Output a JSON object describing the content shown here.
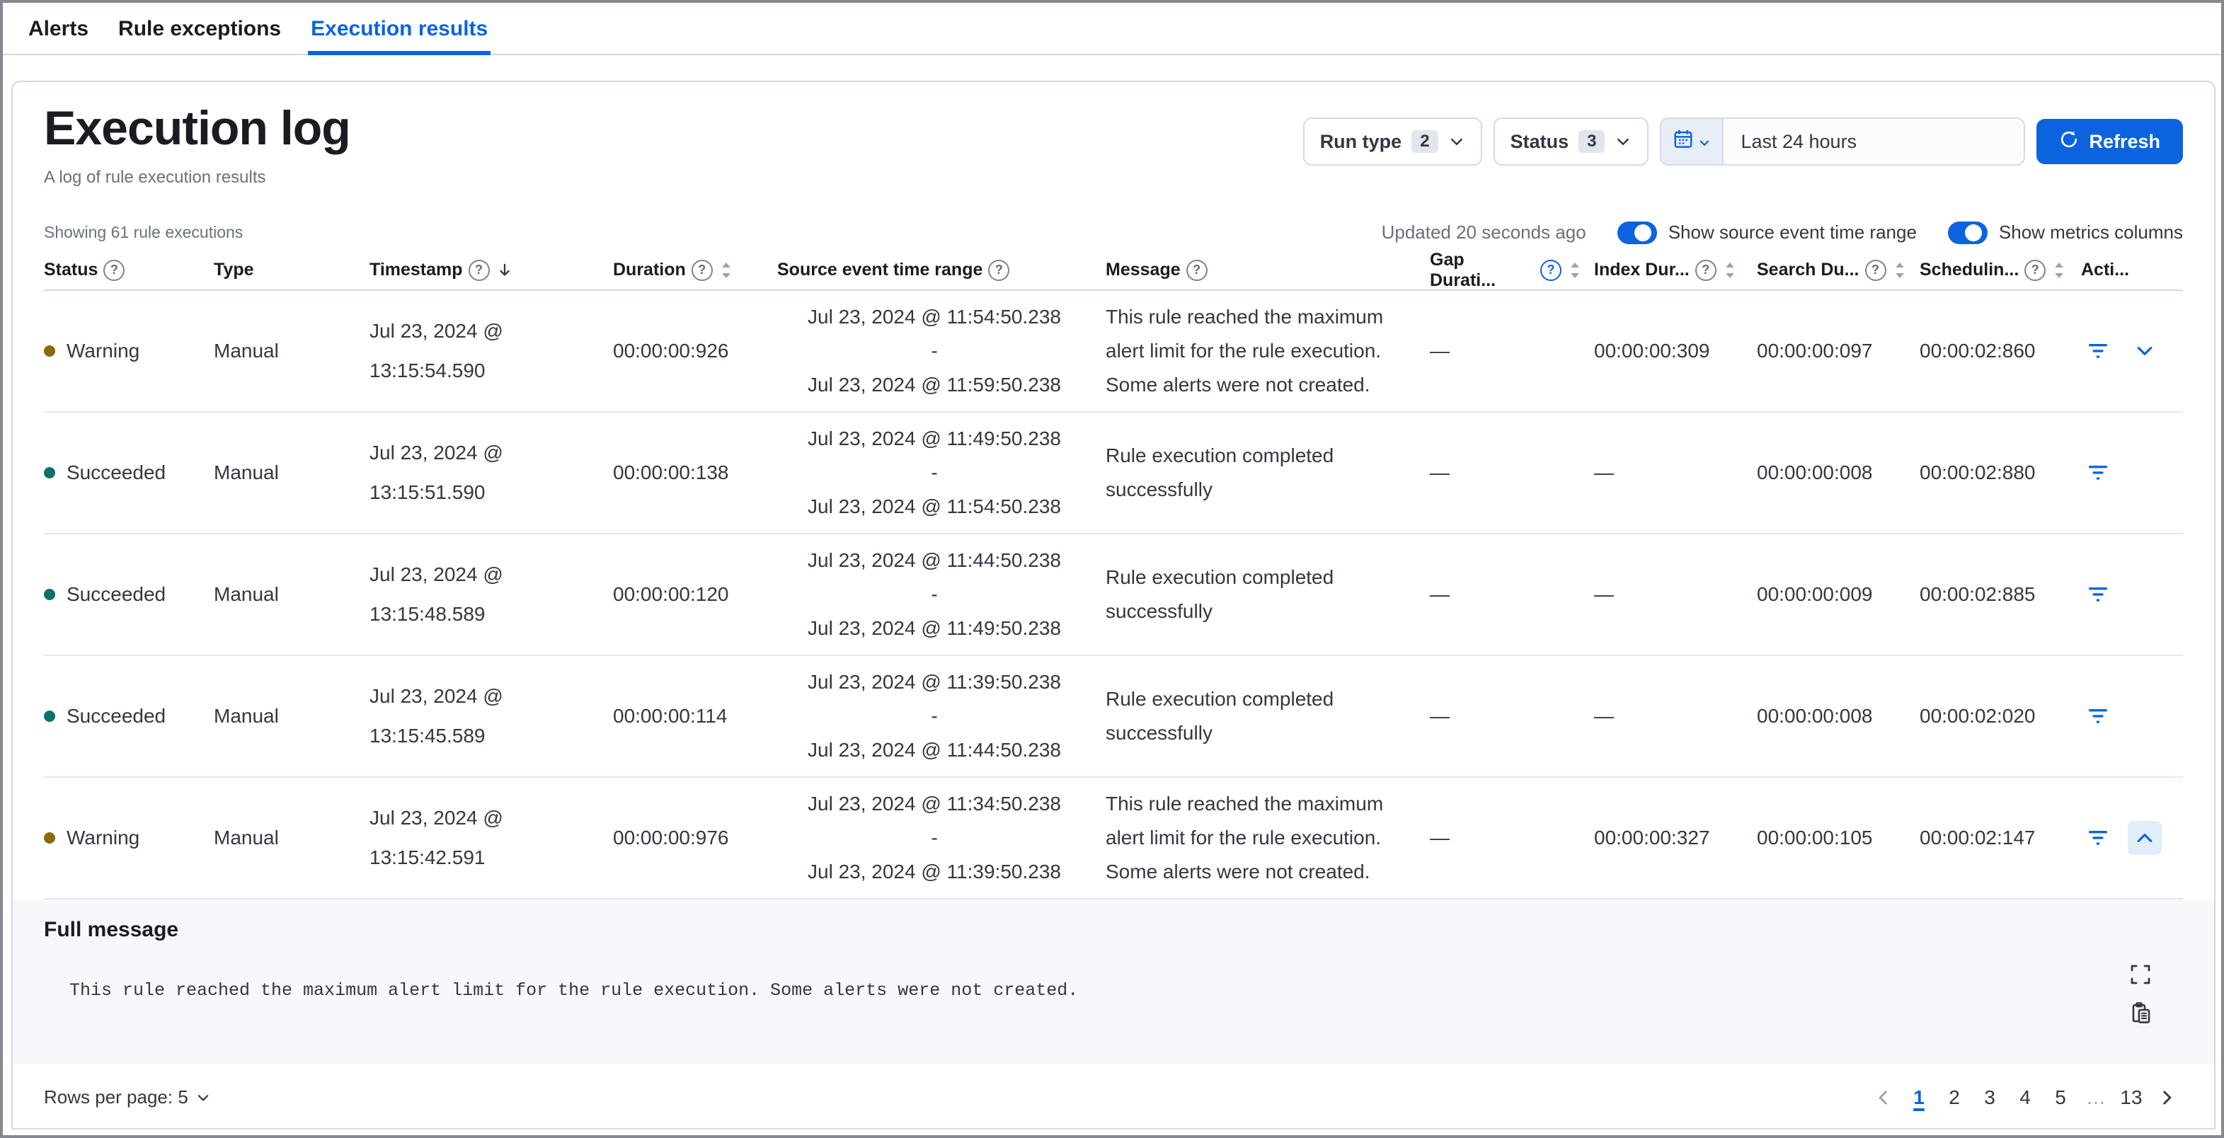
{
  "tabs": [
    {
      "label": "Alerts",
      "active": false
    },
    {
      "label": "Rule exceptions",
      "active": false
    },
    {
      "label": "Execution results",
      "active": true
    }
  ],
  "header": {
    "title": "Execution log",
    "subtitle": "A log of rule execution results"
  },
  "filters": {
    "run_type": {
      "label": "Run type",
      "count": "2",
      "icon": "chevron-down-icon"
    },
    "status": {
      "label": "Status",
      "count": "3",
      "icon": "chevron-down-icon"
    },
    "date_range": {
      "value": "Last 24 hours",
      "icon": "calendar-icon"
    },
    "refresh": {
      "label": "Refresh",
      "icon": "refresh-icon"
    }
  },
  "meta": {
    "showing": "Showing 61 rule executions",
    "updated": "Updated 20 seconds ago",
    "toggles": [
      {
        "label": "Show source event time range",
        "on": true
      },
      {
        "label": "Show metrics columns",
        "on": true
      }
    ]
  },
  "table": {
    "range_separator": "-",
    "columns": [
      {
        "label": "Status",
        "help": true
      },
      {
        "label": "Type"
      },
      {
        "label": "Timestamp",
        "help": true,
        "sort": "desc"
      },
      {
        "label": "Duration",
        "help": true,
        "sort": "sortable"
      },
      {
        "label": "Source event time range",
        "help": true
      },
      {
        "label": "Message",
        "help": true
      },
      {
        "label": "Gap Durati...",
        "help": true,
        "help_active": true,
        "sort": "sortable"
      },
      {
        "label": "Index Dur...",
        "help": true,
        "sort": "sortable"
      },
      {
        "label": "Search Du...",
        "help": true,
        "sort": "sortable"
      },
      {
        "label": "Schedulin...",
        "help": true,
        "sort": "sortable"
      },
      {
        "label": "Acti..."
      }
    ],
    "rows": [
      {
        "status": "Warning",
        "status_kind": "warning",
        "type": "Manual",
        "timestamp": [
          "Jul 23, 2024 @",
          "13:15:54.590"
        ],
        "duration": "00:00:00:926",
        "source_start": "Jul 23, 2024 @ 11:54:50.238",
        "source_end": "Jul 23, 2024 @ 11:59:50.238",
        "message": "This rule reached the maximum alert limit for the rule execution. Some alerts were not created.",
        "gap_duration": "—",
        "index_duration": "00:00:00:309",
        "search_duration": "00:00:00:097",
        "scheduling_delay": "00:00:02:860",
        "expandable": true,
        "expanded": false
      },
      {
        "status": "Succeeded",
        "status_kind": "success",
        "type": "Manual",
        "timestamp": [
          "Jul 23, 2024 @",
          "13:15:51.590"
        ],
        "duration": "00:00:00:138",
        "source_start": "Jul 23, 2024 @ 11:49:50.238",
        "source_end": "Jul 23, 2024 @ 11:54:50.238",
        "message": "Rule execution completed successfully",
        "gap_duration": "—",
        "index_duration": "—",
        "search_duration": "00:00:00:008",
        "scheduling_delay": "00:00:02:880",
        "expandable": false,
        "expanded": false
      },
      {
        "status": "Succeeded",
        "status_kind": "success",
        "type": "Manual",
        "timestamp": [
          "Jul 23, 2024 @",
          "13:15:48.589"
        ],
        "duration": "00:00:00:120",
        "source_start": "Jul 23, 2024 @ 11:44:50.238",
        "source_end": "Jul 23, 2024 @ 11:49:50.238",
        "message": "Rule execution completed successfully",
        "gap_duration": "—",
        "index_duration": "—",
        "search_duration": "00:00:00:009",
        "scheduling_delay": "00:00:02:885",
        "expandable": false,
        "expanded": false
      },
      {
        "status": "Succeeded",
        "status_kind": "success",
        "type": "Manual",
        "timestamp": [
          "Jul 23, 2024 @",
          "13:15:45.589"
        ],
        "duration": "00:00:00:114",
        "source_start": "Jul 23, 2024 @ 11:39:50.238",
        "source_end": "Jul 23, 2024 @ 11:44:50.238",
        "message": "Rule execution completed successfully",
        "gap_duration": "—",
        "index_duration": "—",
        "search_duration": "00:00:00:008",
        "scheduling_delay": "00:00:02:020",
        "expandable": false,
        "expanded": false
      },
      {
        "status": "Warning",
        "status_kind": "warning",
        "type": "Manual",
        "timestamp": [
          "Jul 23, 2024 @",
          "13:15:42.591"
        ],
        "duration": "00:00:00:976",
        "source_start": "Jul 23, 2024 @ 11:34:50.238",
        "source_end": "Jul 23, 2024 @ 11:39:50.238",
        "message": "This rule reached the maximum alert limit for the rule execution. Some alerts were not created.",
        "gap_duration": "—",
        "index_duration": "00:00:00:327",
        "search_duration": "00:00:00:105",
        "scheduling_delay": "00:00:02:147",
        "expandable": true,
        "expanded": true
      }
    ]
  },
  "expanded_panel": {
    "title": "Full message",
    "message": "This rule reached the maximum alert limit for the rule execution. Some alerts were not created.",
    "icons": [
      "fullscreen-icon",
      "copy-icon"
    ]
  },
  "footer": {
    "rows_per_page": "Rows per page: 5",
    "pagination": {
      "pages": [
        {
          "label": "1",
          "active": true
        },
        {
          "label": "2"
        },
        {
          "label": "3"
        },
        {
          "label": "4"
        },
        {
          "label": "5"
        },
        {
          "label": "…",
          "ellipsis": true
        },
        {
          "label": "13"
        }
      ]
    }
  },
  "colors": {
    "primary": "#0b64dd",
    "warning_dot": "#8a6a0b",
    "success_dot": "#0b7269",
    "border": "#d3dae6"
  }
}
